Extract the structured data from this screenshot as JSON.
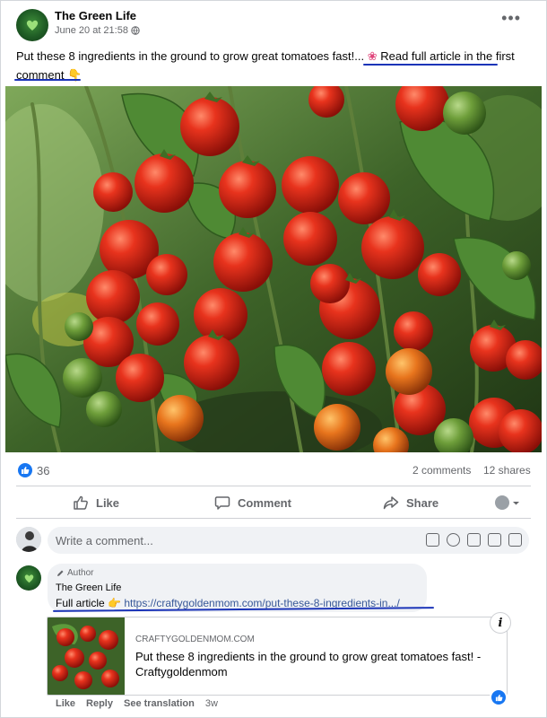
{
  "post": {
    "page_name": "The Green Life",
    "time": "June 20 at 21:58",
    "more_icon": "ellipsis-icon",
    "text_main": "Put these 8 ingredients in the ground to grow great tomatoes fast!...",
    "text_link": "Read full article in the first comment",
    "photo_subject": "cherry-tomato-plant"
  },
  "stats": {
    "likes": "36",
    "comments": "2 comments",
    "shares": "12 shares"
  },
  "actions": {
    "like": "Like",
    "comment": "Comment",
    "share": "Share"
  },
  "comment_box": {
    "placeholder": "Write a comment..."
  },
  "comment": {
    "badge": "Author",
    "name": "The Green Life",
    "prefix": "Full article",
    "url": "https://craftygoldenmom.com/put-these-8-ingredients-in.../",
    "preview_domain": "CRAFTYGOLDENMOM.COM",
    "preview_title": "Put these 8 ingredients in the ground to grow great tomatoes fast! - Craftygoldenmom",
    "like_label": "Like",
    "reply_label": "Reply",
    "translate_label": "See translation",
    "age": "3w"
  },
  "colors": {
    "facebook_blue": "#1877f2",
    "annotation_ink": "#1b34b8",
    "link_text": "#385898"
  }
}
